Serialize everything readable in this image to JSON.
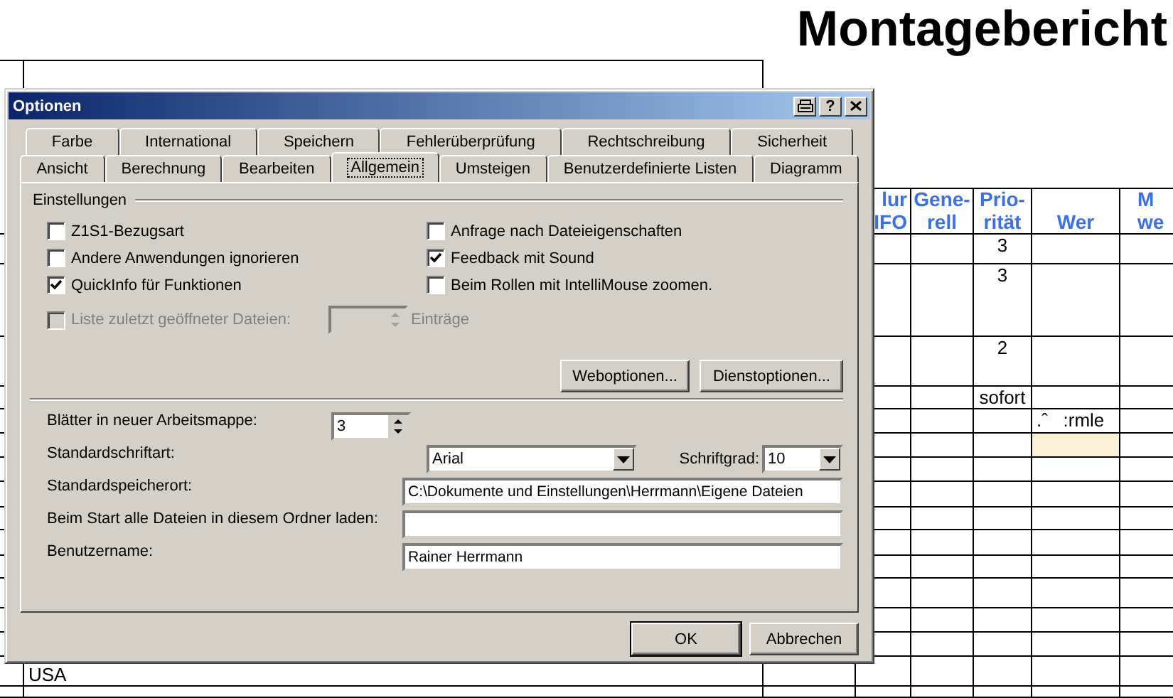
{
  "sheet": {
    "title": "Montagebericht",
    "columns": [
      {
        "label": "lur\nIFO"
      },
      {
        "label": "Gene-\nrell"
      },
      {
        "label": "Prio-\nrität"
      },
      {
        "label": "Wer"
      },
      {
        "label": "M\nwe"
      }
    ],
    "rows": [
      {
        "priority": "3",
        "highlighted": false
      },
      {
        "priority": "3",
        "highlighted": false
      },
      {
        "priority": "2",
        "highlighted": false
      },
      {
        "priority": "sofort",
        "highlighted": false
      },
      {
        "who": ".ˆ   :rmle",
        "highlighted": false
      },
      {
        "highlighted": true
      },
      {
        "highlighted": false
      },
      {
        "highlighted": false
      },
      {
        "highlighted": false
      },
      {
        "highlighted": false
      },
      {
        "highlighted": false
      },
      {
        "highlighted": false
      },
      {
        "highlighted": false
      },
      {
        "highlighted": false
      },
      {
        "left": "USA",
        "highlighted": false
      },
      {
        "highlighted": false
      }
    ]
  },
  "dialog": {
    "title": "Optionen",
    "help": "?",
    "tab_rows": [
      [
        {
          "label": "Farbe",
          "selected": false
        },
        {
          "label": "International",
          "selected": false
        },
        {
          "label": "Speichern",
          "selected": false
        },
        {
          "label": "Fehlerüberprüfung",
          "selected": false
        },
        {
          "label": "Rechtschreibung",
          "selected": false
        },
        {
          "label": "Sicherheit",
          "selected": false
        }
      ],
      [
        {
          "label": "Ansicht",
          "selected": false
        },
        {
          "label": "Berechnung",
          "selected": false
        },
        {
          "label": "Bearbeiten",
          "selected": false
        },
        {
          "label": "Allgemein",
          "selected": true
        },
        {
          "label": "Umsteigen",
          "selected": false
        },
        {
          "label": "Benutzerdefinierte Listen",
          "selected": false
        },
        {
          "label": "Diagramm",
          "selected": false
        }
      ]
    ],
    "group": "Einstellungen",
    "options_left": [
      {
        "label": "Z1S1-Bezugsart",
        "checked": false
      },
      {
        "label": "Andere Anwendungen ignorieren",
        "checked": false
      },
      {
        "label": "QuickInfo für Funktionen",
        "checked": true
      }
    ],
    "options_right": [
      {
        "label": "Anfrage nach Dateieigenschaften",
        "checked": false
      },
      {
        "label": "Feedback mit Sound",
        "checked": true
      },
      {
        "label": "Beim Rollen mit IntelliMouse zoomen.",
        "checked": false
      }
    ],
    "recent_files": {
      "label": "Liste zuletzt geöffneter Dateien:",
      "checked": false,
      "disabled": true,
      "unit": "Einträge"
    },
    "buttons": [
      "Weboptionen...",
      "Dienstoptionen..."
    ],
    "fields": [
      {
        "kind": "spin",
        "label": "Blätter in neuer Arbeitsmappe:",
        "value": "3"
      },
      {
        "kind": "select",
        "label": "Standardschriftart:",
        "value": "Arial",
        "extra_label": "Schriftgrad:",
        "extra_value": "10"
      },
      {
        "kind": "text",
        "label": "Standardspeicherort:",
        "value": "C:\\Dokumente und Einstellungen\\Herrmann\\Eigene Dateien"
      },
      {
        "kind": "text",
        "label": "Beim Start alle Dateien in diesem Ordner laden:"
      },
      {
        "kind": "text",
        "label": "Benutzername:",
        "value": "Rainer Herrmann"
      }
    ],
    "footer_buttons": [
      "OK",
      "Abbrechen"
    ]
  }
}
